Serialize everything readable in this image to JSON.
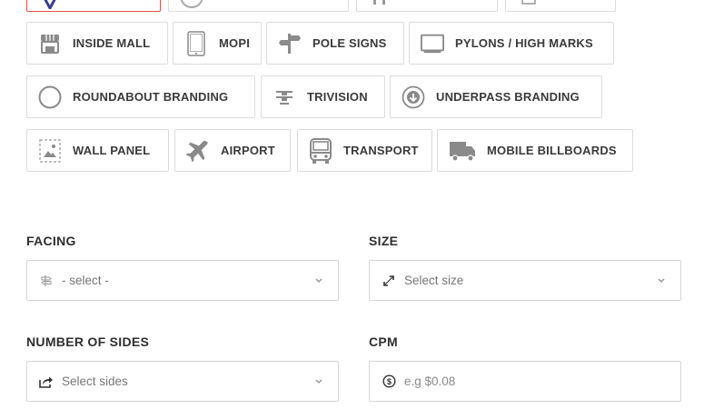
{
  "media_types": {
    "row2": [
      {
        "label": "INSIDE MALL",
        "icon": "storefront-icon"
      },
      {
        "label": "MOPI",
        "icon": "tablet-icon"
      },
      {
        "label": "POLE SIGNS",
        "icon": "signpost-icon"
      },
      {
        "label": "PYLONS / HIGH MARKS",
        "icon": "monitor-icon"
      }
    ],
    "row3": [
      {
        "label": "ROUNDABOUT BRANDING",
        "icon": "circle-icon"
      },
      {
        "label": "TRIVISION",
        "icon": "trivision-icon"
      },
      {
        "label": "UNDERPASS BRANDING",
        "icon": "down-arrow-circle-icon"
      }
    ],
    "row4": [
      {
        "label": "WALL PANEL",
        "icon": "wall-panel-icon"
      },
      {
        "label": "AIRPORT",
        "icon": "airplane-icon"
      },
      {
        "label": "TRANSPORT",
        "icon": "bus-icon"
      },
      {
        "label": "MOBILE BILLBOARDS",
        "icon": "truck-icon"
      }
    ]
  },
  "filters": {
    "facing": {
      "label": "FACING",
      "placeholder": "- select -",
      "icon": "direction-sign-icon"
    },
    "size": {
      "label": "SIZE",
      "placeholder": "Select size",
      "icon": "expand-icon"
    },
    "sides": {
      "label": "NUMBER OF SIDES",
      "placeholder": "Select sides",
      "icon": "share-icon"
    },
    "cpm": {
      "label": "CPM",
      "placeholder": "e.g $0.08",
      "icon": "dollar-circle-icon"
    }
  },
  "colors": {
    "selected_border": "#d9534f",
    "accent_icon": "#3b3f8f"
  }
}
